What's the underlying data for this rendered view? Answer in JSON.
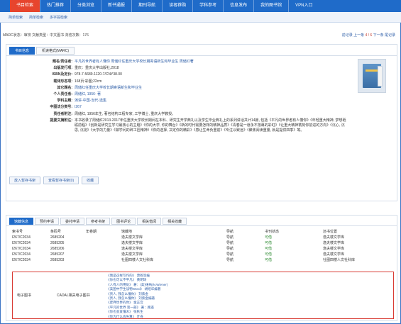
{
  "topnav": {
    "items": [
      {
        "label": "书目检索",
        "active": true
      },
      {
        "label": "热门推荐",
        "active": false
      },
      {
        "label": "分类浏览",
        "active": false
      },
      {
        "label": "新书通报",
        "active": false
      },
      {
        "label": "期刊导航",
        "active": false
      },
      {
        "label": "读者荐购",
        "active": false
      },
      {
        "label": "学科参考",
        "active": false
      },
      {
        "label": "信息发布",
        "active": false
      },
      {
        "label": "我的图书馆",
        "active": false
      },
      {
        "label": "VPN入口",
        "active": false
      }
    ]
  },
  "subnav": {
    "items": [
      "简单检索",
      "简单检索",
      "多字段检索"
    ]
  },
  "status": {
    "left": "MARC状态：审校   文献类型：中文图书   浏览次数：176",
    "right_prefix": "前记录 上一条",
    "current": "4 / 6",
    "right_suffix": "下一条 尾记录"
  },
  "detail_tabs": [
    {
      "label": "书目信息",
      "active": true
    },
    {
      "label": "机读格式(MARC)",
      "active": false
    }
  ],
  "fields": [
    {
      "label": "题名/责任者:",
      "value": "平凡的世界者有人懂你 周储红任重庆大学校长期寄语新生和毕业生 周储红著",
      "link": true
    },
    {
      "label": "出版发行项:",
      "value": "重庆：重庆大学出版社,2018",
      "link": false
    },
    {
      "label": "ISBN及定价:",
      "value": "978-7-5689-1120-7/CNY38.00",
      "link": false
    },
    {
      "label": "载体形态项:",
      "value": "168页:彩图;22cm",
      "link": false
    },
    {
      "label": "其它题名:",
      "value": "周储红任重庆大学校长期寄语新生和毕业生",
      "link": true
    },
    {
      "label": "个人责任者:",
      "value": "周储红, 1956- 著",
      "link": true
    },
    {
      "label": "学科主题:",
      "value": "演讲-中国-当代-选集",
      "link": true
    },
    {
      "label": "中图法分类号:",
      "value": "I267",
      "link": true
    },
    {
      "label": "责任者附注:",
      "value": "周储红, 1956年生, 著名结构工程专家, 工学博士, 重庆大学教授。",
      "link": false
    },
    {
      "label": "提要文摘附注:",
      "value": "本书收录了周储红2013-2017年任重庆大学校长期间在本科、研究生开学典礼以及学生毕业典礼上的系列讲话共计14篇, 包括《平凡的世界者有人懂你》《年轻重大精神, 梦想砥砺前程》《创新是研究生学习最核心的主题》《你的大学, 你的舞台》《新的时代需要怎样的精神品质》《青春是一道永不落幕的彩虹》《让重大精神镌刻你前进的方向》《沉心, 沉思, 沉淀》《大学的力量》《做学问的碎工匠精神》《你的选择, 决定你的精彩》《感让生命负重前》《专注以致远》《聚焦阅读重量, 就是提供四季》等。",
      "link": false
    }
  ],
  "detail_buttons": [
    "放入暂存书架",
    "查看暂存书架(0)",
    "收藏"
  ],
  "holding_tabs": [
    {
      "label": "馆藏信息",
      "active": true
    },
    {
      "label": "预约申请",
      "active": false
    },
    {
      "label": "委托申请",
      "active": false
    },
    {
      "label": "参考书架",
      "active": false
    },
    {
      "label": "图书评论",
      "active": false
    },
    {
      "label": "相关借阅",
      "active": false
    },
    {
      "label": "相关收藏",
      "active": false
    }
  ],
  "holdings_table": {
    "headers": [
      "索书号",
      "条码号",
      "年卷期",
      "馆藏地",
      "导航",
      "书刊状态",
      "还书位置"
    ],
    "rows": [
      [
        "I267/C2034",
        "2685204",
        "",
        "逸夫楼文学库",
        "导航",
        "可借",
        "逸夫楼文学库"
      ],
      [
        "I267/C2034",
        "2685205",
        "",
        "逸夫楼文学库",
        "导航",
        "可借",
        "逸夫楼文学库"
      ],
      [
        "I267/C2034",
        "2685206",
        "",
        "逸夫楼文学库",
        "导航",
        "可借",
        "逸夫楼文学库"
      ],
      [
        "I267/C2034",
        "2685207",
        "",
        "逸夫楼文学库",
        "导航",
        "可借",
        "逸夫楼文学库"
      ],
      [
        "I267/C2034",
        "2685203",
        "",
        "社图四楼人文社科库",
        "导航",
        "可借",
        "社图四楼人文社科库"
      ]
    ]
  },
  "ebooks": {
    "label": "电子图书",
    "source": "CADAL相关电子图书",
    "items": [
      "《我是这样写作的》 萧乾等编",
      "《你也可以不平凡》 黄明琦",
      "《人有人的用处》 著：(美)维纳(N.Wiener)",
      "《美国中学生读物Word》 胡绍华编著",
      "《贵人, 我怎么懂你》 刘紫金",
      "《贵人, 我怎么懂你》 刘紫金编著",
      "《废弃世界的你》 金正宫",
      "《平凡的世界 第一部》 著：路遥",
      "《你也会爱懂木》 张秋生",
      "《你为什么会失算》 叶舟"
    ]
  }
}
